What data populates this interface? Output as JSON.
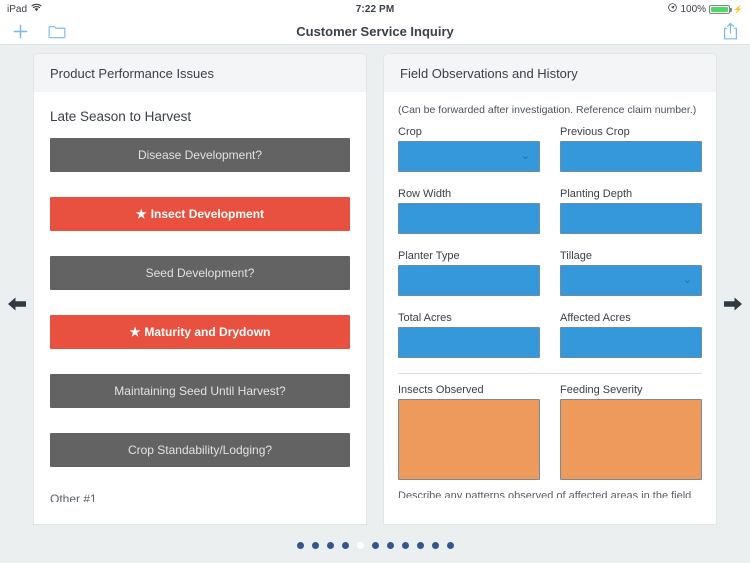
{
  "status_bar": {
    "device": "iPad",
    "wifi_icon": "wifi-icon",
    "time": "7:22 PM",
    "battery_text": "100%",
    "location_icon": "location-arrow-icon",
    "charging_icon": "lightning-bolt-icon"
  },
  "nav_bar": {
    "title": "Customer Service Inquiry",
    "add_icon": "plus-icon",
    "folder_icon": "folder-icon",
    "share_icon": "share-icon"
  },
  "navigation": {
    "prev_icon": "arrow-left-icon",
    "next_icon": "arrow-right-icon"
  },
  "left_panel": {
    "header": "Product Performance Issues",
    "section_title": "Late Season to Harvest",
    "items": [
      {
        "label": "Disease Development?",
        "state": "gray",
        "starred": false
      },
      {
        "label": "Insect Development",
        "state": "red",
        "starred": true
      },
      {
        "label": "Seed Development?",
        "state": "gray",
        "starred": false
      },
      {
        "label": "Maturity and Drydown",
        "state": "red",
        "starred": true
      },
      {
        "label": "Maintaining Seed Until Harvest?",
        "state": "gray",
        "starred": false
      },
      {
        "label": "Crop Standability/Lodging?",
        "state": "gray",
        "starred": false
      }
    ],
    "partial_item": "Other #1",
    "star_glyph": "★"
  },
  "right_panel": {
    "header": "Field Observations and History",
    "note": "(Can be forwarded after investigation. Reference claim number.)",
    "fields": [
      {
        "label": "Crop",
        "value": "",
        "type": "select",
        "chevron": true
      },
      {
        "label": "Previous Crop",
        "value": "",
        "type": "text",
        "chevron": false
      },
      {
        "label": "Row Width",
        "value": "",
        "type": "text",
        "chevron": false
      },
      {
        "label": "Planting Depth",
        "value": "",
        "type": "text",
        "chevron": false
      },
      {
        "label": "Planter Type",
        "value": "",
        "type": "text",
        "chevron": false
      },
      {
        "label": "Tillage",
        "value": "",
        "type": "select",
        "chevron": true
      },
      {
        "label": "Total Acres",
        "value": "",
        "type": "text",
        "chevron": false
      },
      {
        "label": "Affected Acres",
        "value": "",
        "type": "text",
        "chevron": false
      }
    ],
    "textareas": [
      {
        "label": "Insects Observed",
        "value": ""
      },
      {
        "label": "Feeding Severity",
        "value": ""
      }
    ],
    "partial_text": "Describe any patterns observed of affected areas in the field.",
    "chevron_glyph": "⌄"
  },
  "pagination": {
    "total": 11,
    "active_index": 4
  },
  "colors": {
    "accent_blue": "#3498db",
    "alert_red": "#e8503f",
    "neutral_gray": "#636363",
    "textarea_orange": "#ed9a5c",
    "page_background": "#eceff0",
    "dot_color": "#33568c"
  }
}
